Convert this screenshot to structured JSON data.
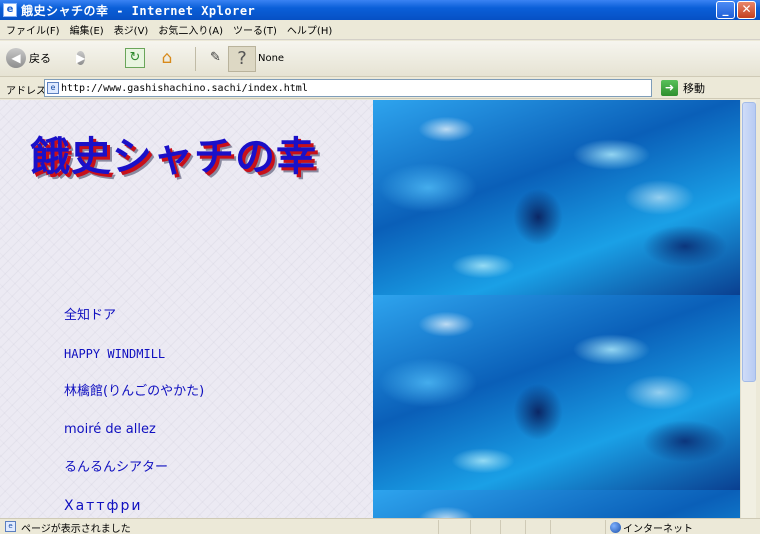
{
  "window": {
    "title": "餓史シャチの幸 - Internet Xplorer",
    "minimize_glyph": "_",
    "close_glyph": "✕"
  },
  "menu": {
    "items": [
      "ファイル(F)",
      "編集(E)",
      "表ジ(V)",
      "お気二入り(A)",
      "ツーる(T)",
      "ヘルプ(H)"
    ]
  },
  "toolbar": {
    "back_label": "戻る",
    "style_label": "None"
  },
  "address": {
    "label": "アドレス",
    "url": "http://www.gashishachino.sachi/index.html",
    "go_label": "移動"
  },
  "page": {
    "title": "餓史シャチの幸",
    "links": [
      "全知ドア",
      "HAPPY WINDMILL",
      "林檎館(りんごのやかた)",
      "moiré de allez",
      "るんるんシアター",
      "Хаттфри"
    ]
  },
  "status": {
    "text": "ページが表示されました",
    "zone": "インターネット"
  },
  "colors": {
    "title_fill": "#1a10c8",
    "title_shadow": "#c8101a",
    "link": "#1010c0",
    "titlebar": "#0a5fd8"
  },
  "icons": {
    "back": "back-arrow-icon",
    "forward": "forward-arrow-icon",
    "refresh": "refresh-icon",
    "home": "home-icon",
    "dropper": "eyedropper-icon",
    "style": "style-icon",
    "go": "go-arrow-icon",
    "zone": "globe-icon"
  }
}
